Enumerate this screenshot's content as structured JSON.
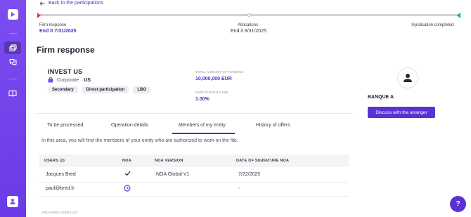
{
  "nav": {
    "back_label": "Back to the participations"
  },
  "progress": {
    "steps": [
      {
        "label": "Firm response",
        "date": "End it 7/31/2025"
      },
      {
        "label": "Allocations",
        "date": "End it 8/31/2025"
      },
      {
        "label": "Syndication completed",
        "date": ""
      }
    ],
    "colors": {
      "start": "#e43d52",
      "end": "#1fa59a",
      "track": "#d2d0d8"
    }
  },
  "page": {
    "title": "Firm response"
  },
  "deal": {
    "company": "INVEST US",
    "type": "Corporate",
    "country": "US",
    "chips": [
      "Secondary",
      "Direct participation",
      "LBO"
    ],
    "funding_label": "TOTAL AMOUNT OF FUNDING",
    "funding_value": "10,000,000 EUR",
    "fee_label": "PARTICIPATION FEE",
    "fee_value": "1.00%"
  },
  "arranger": {
    "bank": "BANQUE A",
    "button_label": "Discuss with the arranger"
  },
  "tabs": [
    {
      "label": "To be processed",
      "active": false
    },
    {
      "label": "Operation details",
      "active": false
    },
    {
      "label": "Members of my entity",
      "active": true
    },
    {
      "label": "History of offers",
      "active": false
    }
  ],
  "members": {
    "info": "In this area, you will find the members of your entity who are authorized to work on the file.",
    "columns": [
      "USERS (2)",
      "NOA",
      "NOA VERSION",
      "DATE OF SIGNATURE NOA"
    ],
    "rows": [
      {
        "user": "Jacques Bred",
        "noa": "check-icon",
        "version": "NOA Global V1",
        "date": "7/22/2025"
      },
      {
        "user": "paul@bred.fr",
        "noa": "clock-icon",
        "version": "",
        "date": "-"
      }
    ],
    "archived_label": "ARCHIVED USERS (0)"
  },
  "help": {
    "label": "?"
  },
  "theme": {
    "accent": "#5a32d3",
    "link": "#4c2fc2",
    "sidebar": "#7c4df1"
  }
}
